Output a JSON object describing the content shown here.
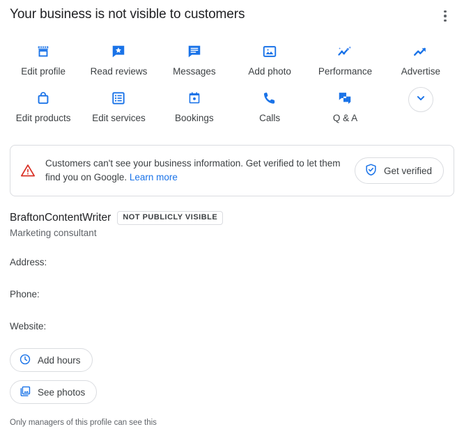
{
  "header": {
    "title": "Your business is not visible to customers",
    "menu_icon": "more-vert-icon"
  },
  "actions": {
    "row1": [
      {
        "label": "Edit profile",
        "icon": "storefront-icon"
      },
      {
        "label": "Read reviews",
        "icon": "review-star-bubble-icon"
      },
      {
        "label": "Messages",
        "icon": "message-bubble-icon"
      },
      {
        "label": "Add photo",
        "icon": "photo-icon"
      },
      {
        "label": "Performance",
        "icon": "performance-chart-icon"
      },
      {
        "label": "Advertise",
        "icon": "trending-up-icon"
      }
    ],
    "row2": [
      {
        "label": "Edit products",
        "icon": "shopping-bag-icon"
      },
      {
        "label": "Edit services",
        "icon": "list-grid-icon"
      },
      {
        "label": "Bookings",
        "icon": "calendar-icon"
      },
      {
        "label": "Calls",
        "icon": "phone-icon"
      },
      {
        "label": "Q & A",
        "icon": "qa-bubbles-icon"
      }
    ],
    "expand_icon": "chevron-down-icon"
  },
  "verify_card": {
    "warning_icon": "warning-triangle-icon",
    "message_part1": "Customers can't see your business information. Get verified to let them find you on Google.",
    "learn_more": "Learn more",
    "button_label": "Get verified",
    "button_icon": "shield-check-icon"
  },
  "business": {
    "name": "BraftonContentWriter",
    "badge": "NOT PUBLICLY VISIBLE",
    "category": "Marketing consultant",
    "fields": [
      {
        "label": "Address:",
        "value": ""
      },
      {
        "label": "Phone:",
        "value": ""
      },
      {
        "label": "Website:",
        "value": ""
      }
    ]
  },
  "buttons": [
    {
      "label": "Add hours",
      "icon": "clock-icon"
    },
    {
      "label": "See photos",
      "icon": "photo-library-icon"
    }
  ],
  "footnote": "Only managers of this profile can see this",
  "colors": {
    "accent_blue": "#1a73e8",
    "warning_red": "#d93025",
    "text_primary": "#202124",
    "text_secondary": "#5f6368",
    "border": "#dadce0"
  }
}
